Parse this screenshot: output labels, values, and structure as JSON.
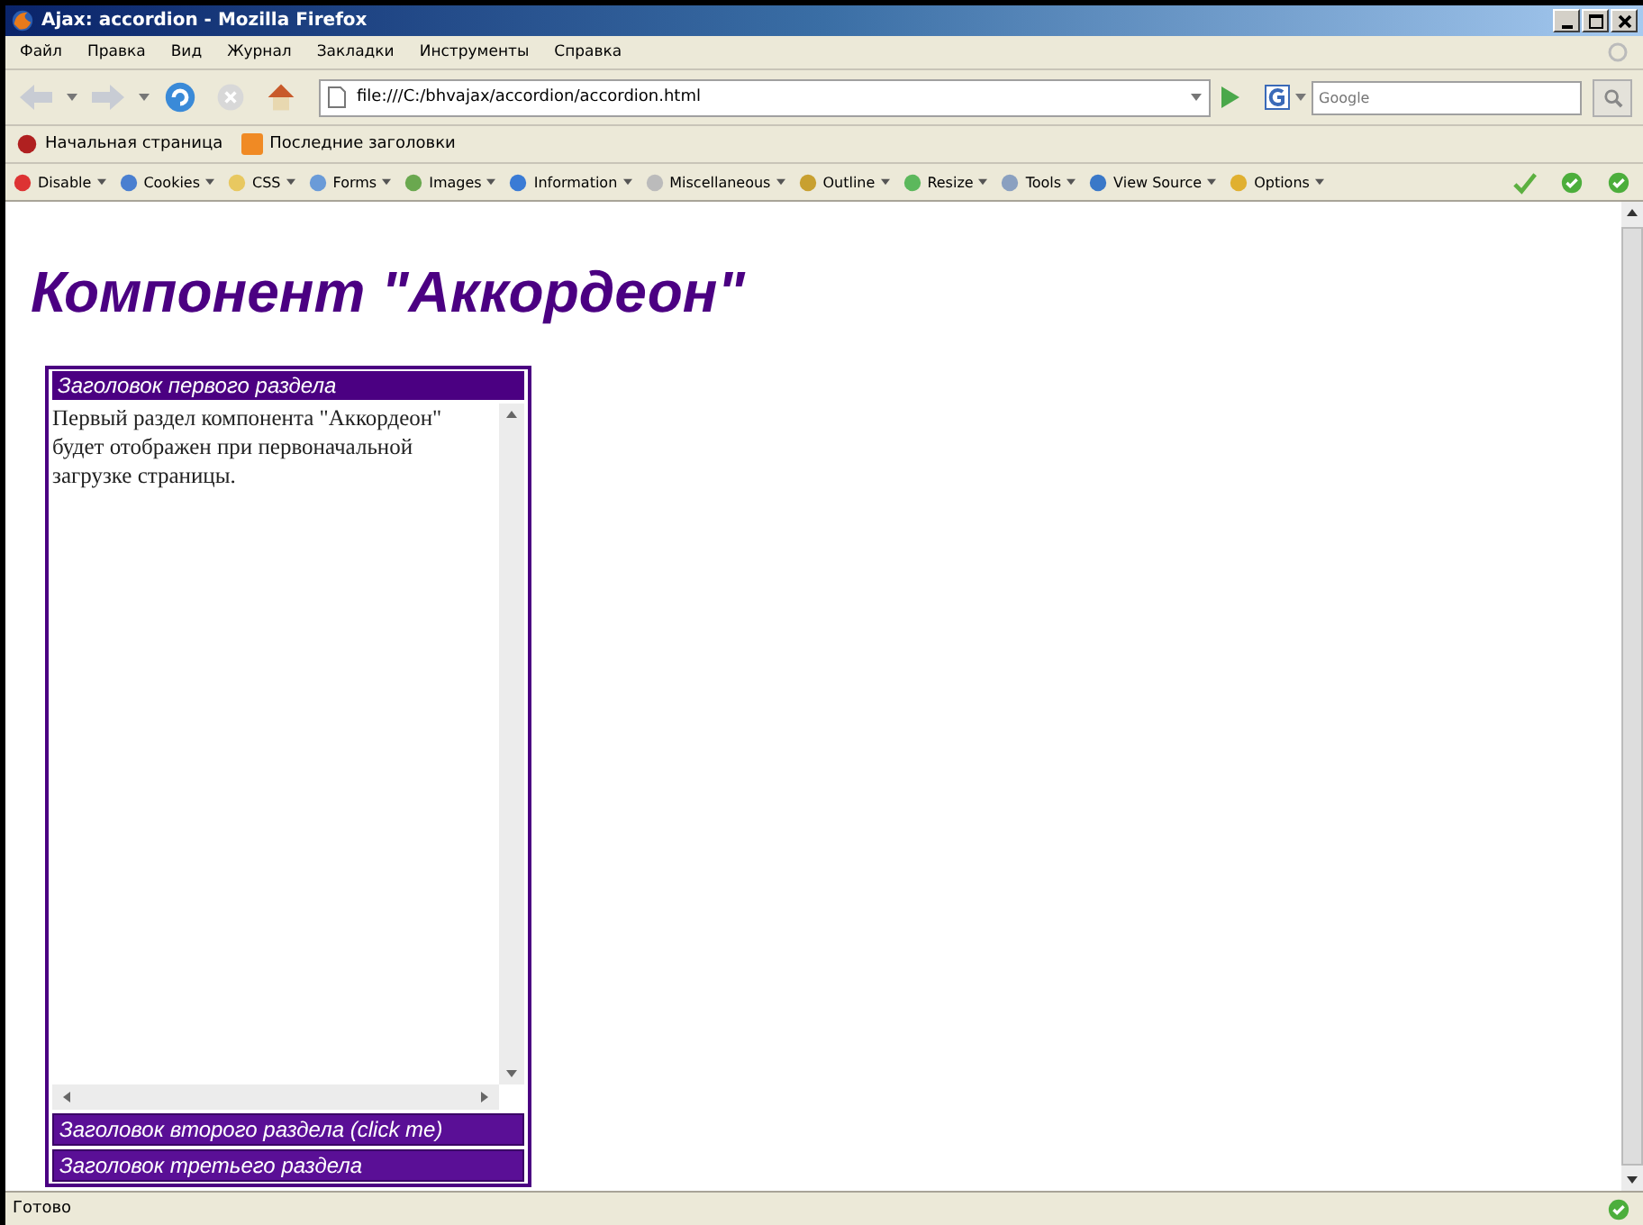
{
  "window": {
    "title": "Ajax: accordion - Mozilla Firefox"
  },
  "menu": [
    "Файл",
    "Правка",
    "Вид",
    "Журнал",
    "Закладки",
    "Инструменты",
    "Справка"
  ],
  "navigation": {
    "url": "file:///C:/bhvajax/accordion/accordion.html",
    "search_placeholder": "Google"
  },
  "bookmarks": [
    "Начальная страница",
    "Последние заголовки"
  ],
  "dev_toolbar": [
    "Disable",
    "Cookies",
    "CSS",
    "Forms",
    "Images",
    "Information",
    "Miscellaneous",
    "Outline",
    "Resize",
    "Tools",
    "View Source",
    "Options"
  ],
  "page": {
    "heading": "Компонент \"Аккордеон\"",
    "sections": [
      {
        "title": "Заголовок первого раздела",
        "expanded": true,
        "body": "Первый раздел компонента \"Аккордеон\" будет отображен при первоначальной загрузке страницы."
      },
      {
        "title": "Заголовок второго раздела (click me)",
        "expanded": false
      },
      {
        "title": "Заголовок третьего раздела",
        "expanded": false
      }
    ]
  },
  "status_bar": {
    "text": "Готово"
  }
}
